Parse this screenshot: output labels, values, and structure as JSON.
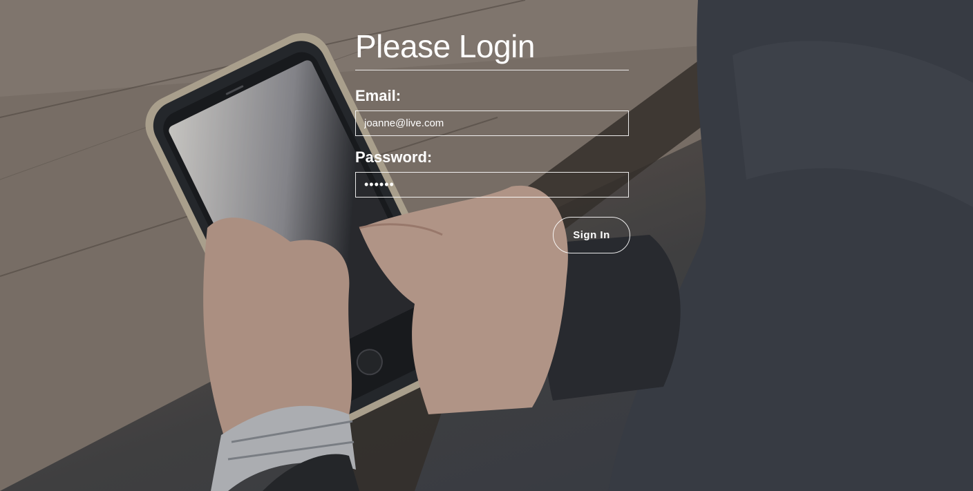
{
  "login": {
    "title": "Please Login",
    "email_label": "Email:",
    "email_value": "joanne@live.com",
    "password_label": "Password:",
    "password_value": "••••••",
    "signin_label": "Sign In"
  },
  "colors": {
    "text": "#ffffff",
    "border": "#ffffff"
  }
}
